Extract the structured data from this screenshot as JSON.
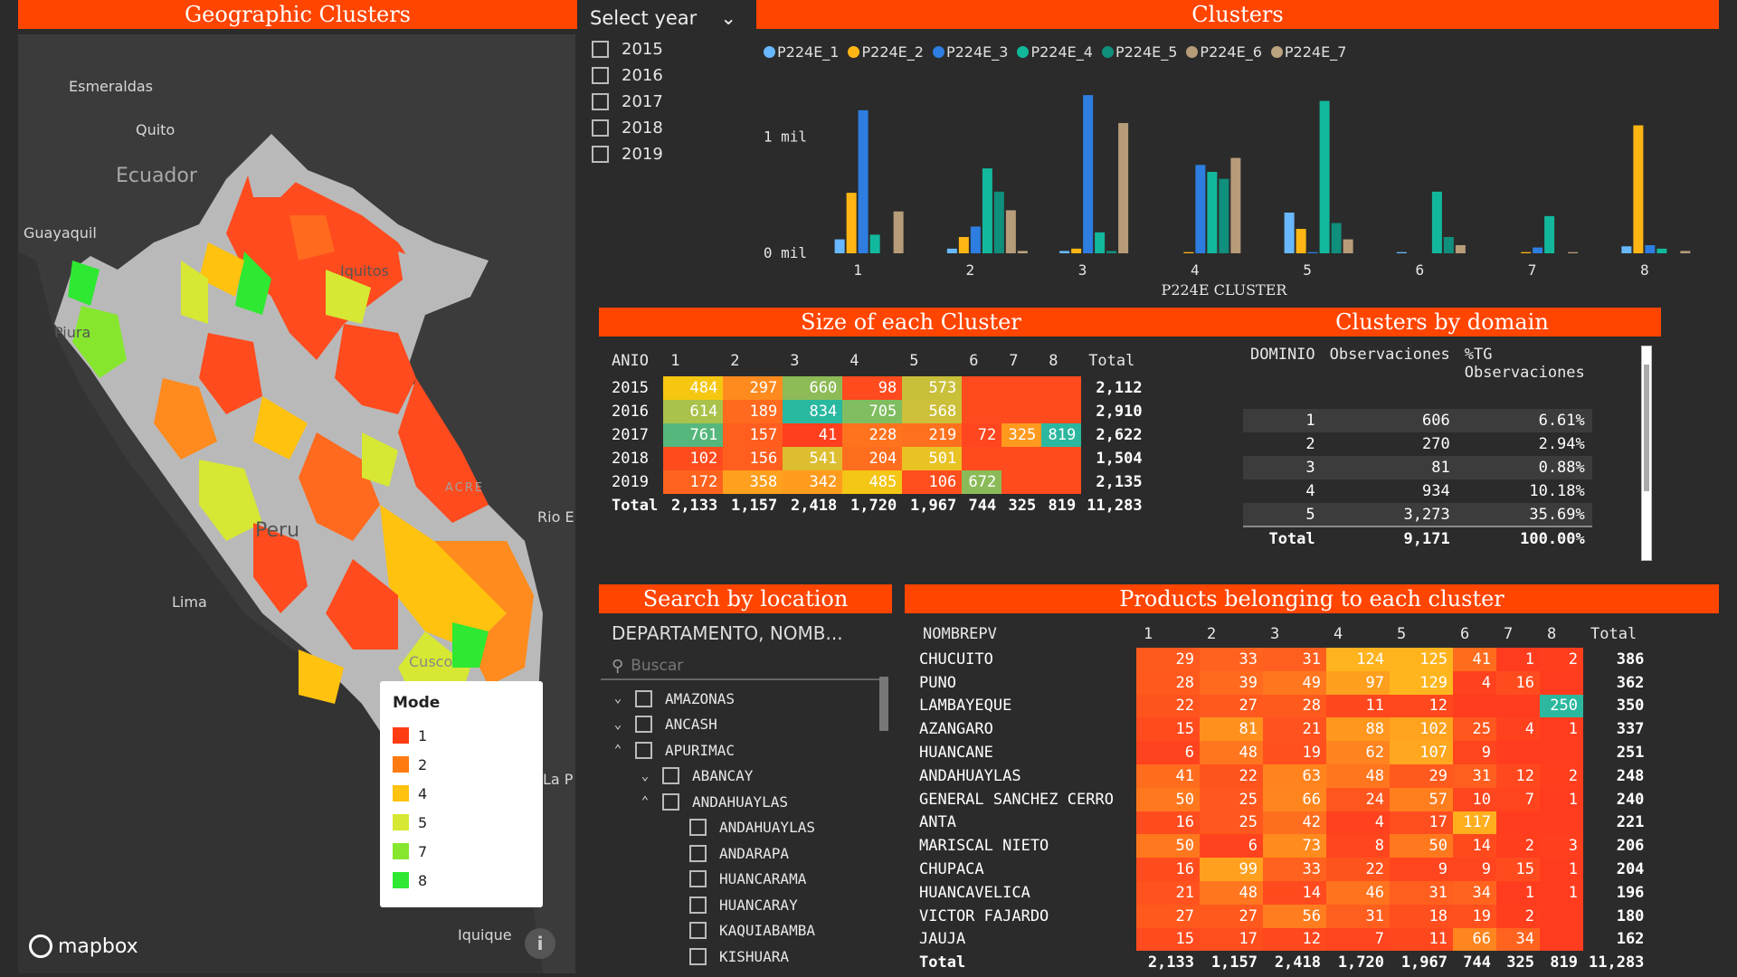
{
  "headers": {
    "geo": "Geographic Clusters",
    "clusters": "Clusters",
    "size": "Size of each Cluster",
    "domain": "Clusters by domain",
    "search": "Search by location",
    "products": "Products belonging to each cluster"
  },
  "map": {
    "labels": [
      "Esmeraldas",
      "Quito",
      "Ecuador",
      "Guayaquil",
      "Iquitos",
      "Piura",
      "ACRE",
      "Rio E",
      "Peru",
      "Lima",
      "Cusco",
      "La P",
      "Iquique"
    ],
    "legend_title": "Mode",
    "legend": [
      {
        "label": "1",
        "color": "#ff3d14"
      },
      {
        "label": "2",
        "color": "#ff7a10"
      },
      {
        "label": "4",
        "color": "#ffc20e"
      },
      {
        "label": "5",
        "color": "#d6e833"
      },
      {
        "label": "7",
        "color": "#86e62e"
      },
      {
        "label": "8",
        "color": "#2ee832"
      }
    ],
    "attribution": "mapbox",
    "info": "i"
  },
  "year_slicer": {
    "title": "Select year",
    "years": [
      "2015",
      "2016",
      "2017",
      "2018",
      "2019"
    ]
  },
  "chart_data": {
    "type": "bar",
    "categories": [
      "1",
      "2",
      "3",
      "4",
      "5",
      "6",
      "7",
      "8"
    ],
    "xlabel": "P224E CLUSTER",
    "ylabel": "",
    "yticks": [
      "0 mil",
      "1 mil"
    ],
    "ylim": [
      0,
      1400
    ],
    "series": [
      {
        "name": "P224E_1",
        "color": "#68b8ff",
        "values": [
          120,
          40,
          20,
          0,
          350,
          10,
          0,
          60
        ]
      },
      {
        "name": "P224E_2",
        "color": "#ffb615",
        "values": [
          520,
          140,
          40,
          10,
          210,
          0,
          10,
          1100
        ]
      },
      {
        "name": "P224E_3",
        "color": "#2d7ee0",
        "values": [
          1230,
          230,
          1360,
          760,
          10,
          0,
          50,
          70
        ]
      },
      {
        "name": "P224E_4",
        "color": "#12b89c",
        "values": [
          160,
          730,
          180,
          700,
          1310,
          530,
          320,
          40
        ]
      },
      {
        "name": "P224E_5",
        "color": "#0f8f7c",
        "values": [
          0,
          530,
          20,
          640,
          260,
          140,
          0,
          0
        ]
      },
      {
        "name": "P224E_6",
        "color": "#b79c7a",
        "values": [
          360,
          370,
          1120,
          820,
          120,
          70,
          10,
          20
        ]
      },
      {
        "name": "P224E_7",
        "color": "#bca37f",
        "values": [
          0,
          20,
          0,
          0,
          0,
          0,
          0,
          0
        ]
      }
    ]
  },
  "size_table": {
    "columns": [
      "ANIO",
      "1",
      "2",
      "3",
      "4",
      "5",
      "6",
      "7",
      "8",
      "Total"
    ],
    "rows": [
      {
        "year": "2015",
        "cells": [
          {
            "v": "484",
            "c": "#f5c710"
          },
          {
            "v": "297",
            "c": "#ff8a1e"
          },
          {
            "v": "660",
            "c": "#8dbb57"
          },
          {
            "v": "98",
            "c": "#ff4b1e"
          },
          {
            "v": "573",
            "c": "#c9c03a"
          },
          {
            "v": "",
            "c": "#ff4b1e"
          },
          {
            "v": "",
            "c": "#ff4b1e"
          },
          {
            "v": "",
            "c": "#ff4b1e"
          }
        ],
        "total": "2,112"
      },
      {
        "year": "2016",
        "cells": [
          {
            "v": "614",
            "c": "#a9c24b"
          },
          {
            "v": "189",
            "c": "#ff6a1e"
          },
          {
            "v": "834",
            "c": "#29b8a0"
          },
          {
            "v": "705",
            "c": "#7fbd60"
          },
          {
            "v": "568",
            "c": "#ccbf3a"
          },
          {
            "v": "",
            "c": "#ff4b1e"
          },
          {
            "v": "",
            "c": "#ff4b1e"
          },
          {
            "v": "",
            "c": "#ff4b1e"
          }
        ],
        "total": "2,910"
      },
      {
        "year": "2017",
        "cells": [
          {
            "v": "761",
            "c": "#55b77b"
          },
          {
            "v": "157",
            "c": "#ff5e1e"
          },
          {
            "v": "41",
            "c": "#ff3f1e"
          },
          {
            "v": "228",
            "c": "#ff721e"
          },
          {
            "v": "219",
            "c": "#ff701e"
          },
          {
            "v": "72",
            "c": "#ff461e"
          },
          {
            "v": "325",
            "c": "#ff9a1e"
          },
          {
            "v": "819",
            "c": "#2cb89e"
          }
        ],
        "total": "2,622"
      },
      {
        "year": "2018",
        "cells": [
          {
            "v": "102",
            "c": "#ff4c1e"
          },
          {
            "v": "156",
            "c": "#ff5e1e"
          },
          {
            "v": "541",
            "c": "#dcbe30"
          },
          {
            "v": "204",
            "c": "#ff6d1e"
          },
          {
            "v": "501",
            "c": "#e9c224"
          },
          {
            "v": "",
            "c": "#ff4b1e"
          },
          {
            "v": "",
            "c": "#ff4b1e"
          },
          {
            "v": "",
            "c": "#ff4b1e"
          }
        ],
        "total": "1,504"
      },
      {
        "year": "2019",
        "cells": [
          {
            "v": "172",
            "c": "#ff631e"
          },
          {
            "v": "358",
            "c": "#ffa01e"
          },
          {
            "v": "342",
            "c": "#ff9c1e"
          },
          {
            "v": "485",
            "c": "#f4c616"
          },
          {
            "v": "106",
            "c": "#ff4e1e"
          },
          {
            "v": "672",
            "c": "#8bbb58"
          },
          {
            "v": "",
            "c": "#ff4b1e"
          },
          {
            "v": "",
            "c": "#ff4b1e"
          }
        ],
        "total": "2,135"
      }
    ],
    "total_row": [
      "Total",
      "2,133",
      "1,157",
      "2,418",
      "1,720",
      "1,967",
      "744",
      "325",
      "819",
      "11,283"
    ]
  },
  "domain_table": {
    "columns": [
      "DOMINIO",
      "Observaciones",
      "%TG Observaciones"
    ],
    "rows": [
      [
        "1",
        "606",
        "6.61%"
      ],
      [
        "2",
        "270",
        "2.94%"
      ],
      [
        "3",
        "81",
        "0.88%"
      ],
      [
        "4",
        "934",
        "10.18%"
      ],
      [
        "5",
        "3,273",
        "35.69%"
      ]
    ],
    "total_row": [
      "Total",
      "9,171",
      "100.00%"
    ]
  },
  "location_slicer": {
    "field": "DEPARTAMENTO, NOMB...",
    "search_placeholder": "Buscar",
    "items": [
      {
        "label": "AMAZONAS",
        "level": 0,
        "chev": "⌄"
      },
      {
        "label": "ANCASH",
        "level": 0,
        "chev": "⌄"
      },
      {
        "label": "APURIMAC",
        "level": 0,
        "chev": "⌃"
      },
      {
        "label": "ABANCAY",
        "level": 1,
        "chev": "⌄"
      },
      {
        "label": "ANDAHUAYLAS",
        "level": 1,
        "chev": "⌃"
      },
      {
        "label": "ANDAHUAYLAS",
        "level": 2,
        "chev": ""
      },
      {
        "label": "ANDARAPA",
        "level": 2,
        "chev": ""
      },
      {
        "label": "HUANCARAMA",
        "level": 2,
        "chev": ""
      },
      {
        "label": "HUANCARAY",
        "level": 2,
        "chev": ""
      },
      {
        "label": "KAQUIABAMBA",
        "level": 2,
        "chev": ""
      },
      {
        "label": "KISHUARA",
        "level": 2,
        "chev": ""
      }
    ]
  },
  "product_table": {
    "columns": [
      "NOMBREPV",
      "1",
      "2",
      "3",
      "4",
      "5",
      "6",
      "7",
      "8",
      "Total"
    ],
    "rows": [
      {
        "name": "CHUCUITO",
        "cells": [
          {
            "v": "29",
            "c": "#ff5a1e"
          },
          {
            "v": "33",
            "c": "#ff621e"
          },
          {
            "v": "31",
            "c": "#ff5f1e"
          },
          {
            "v": "124",
            "c": "#ffb31e"
          },
          {
            "v": "125",
            "c": "#ffb41e"
          },
          {
            "v": "41",
            "c": "#ff6c1e"
          },
          {
            "v": "1",
            "c": "#ff3d1e"
          },
          {
            "v": "2",
            "c": "#ff3e1e"
          }
        ],
        "total": "386"
      },
      {
        "name": "PUNO",
        "cells": [
          {
            "v": "28",
            "c": "#ff591e"
          },
          {
            "v": "39",
            "c": "#ff6a1e"
          },
          {
            "v": "49",
            "c": "#ff761e"
          },
          {
            "v": "97",
            "c": "#ff9f1e"
          },
          {
            "v": "129",
            "c": "#ffb61e"
          },
          {
            "v": "4",
            "c": "#ff411e"
          },
          {
            "v": "16",
            "c": "#ff4c1e"
          },
          {
            "v": "",
            "c": "#ff3d1e"
          }
        ],
        "total": "362"
      },
      {
        "name": "LAMBAYEQUE",
        "cells": [
          {
            "v": "22",
            "c": "#ff531e"
          },
          {
            "v": "27",
            "c": "#ff591e"
          },
          {
            "v": "28",
            "c": "#ff5a1e"
          },
          {
            "v": "11",
            "c": "#ff471e"
          },
          {
            "v": "12",
            "c": "#ff481e"
          },
          {
            "v": "",
            "c": "#ff3d1e"
          },
          {
            "v": "",
            "c": "#ff3d1e"
          },
          {
            "v": "250",
            "c": "#2cb89e"
          }
        ],
        "total": "350"
      },
      {
        "name": "AZANGARO",
        "cells": [
          {
            "v": "15",
            "c": "#ff4b1e"
          },
          {
            "v": "81",
            "c": "#ff901e"
          },
          {
            "v": "21",
            "c": "#ff521e"
          },
          {
            "v": "88",
            "c": "#ff961e"
          },
          {
            "v": "102",
            "c": "#ffa31e"
          },
          {
            "v": "25",
            "c": "#ff571e"
          },
          {
            "v": "4",
            "c": "#ff411e"
          },
          {
            "v": "1",
            "c": "#ff3d1e"
          }
        ],
        "total": "337"
      },
      {
        "name": "HUANCANE",
        "cells": [
          {
            "v": "6",
            "c": "#ff431e"
          },
          {
            "v": "48",
            "c": "#ff761e"
          },
          {
            "v": "19",
            "c": "#ff501e"
          },
          {
            "v": "62",
            "c": "#ff831e"
          },
          {
            "v": "107",
            "c": "#ffa71e"
          },
          {
            "v": "9",
            "c": "#ff451e"
          },
          {
            "v": "",
            "c": "#ff3d1e"
          },
          {
            "v": "",
            "c": "#ff3d1e"
          }
        ],
        "total": "251"
      },
      {
        "name": "ANDAHUAYLAS",
        "cells": [
          {
            "v": "41",
            "c": "#ff6c1e"
          },
          {
            "v": "22",
            "c": "#ff531e"
          },
          {
            "v": "63",
            "c": "#ff841e"
          },
          {
            "v": "48",
            "c": "#ff761e"
          },
          {
            "v": "29",
            "c": "#ff5a1e"
          },
          {
            "v": "31",
            "c": "#ff5f1e"
          },
          {
            "v": "12",
            "c": "#ff481e"
          },
          {
            "v": "2",
            "c": "#ff3e1e"
          }
        ],
        "total": "248"
      },
      {
        "name": "GENERAL SANCHEZ CERRO",
        "cells": [
          {
            "v": "50",
            "c": "#ff781e"
          },
          {
            "v": "25",
            "c": "#ff571e"
          },
          {
            "v": "66",
            "c": "#ff861e"
          },
          {
            "v": "24",
            "c": "#ff561e"
          },
          {
            "v": "57",
            "c": "#ff7e1e"
          },
          {
            "v": "10",
            "c": "#ff461e"
          },
          {
            "v": "7",
            "c": "#ff441e"
          },
          {
            "v": "1",
            "c": "#ff3d1e"
          }
        ],
        "total": "240"
      },
      {
        "name": "ANTA",
        "cells": [
          {
            "v": "16",
            "c": "#ff4c1e"
          },
          {
            "v": "25",
            "c": "#ff571e"
          },
          {
            "v": "42",
            "c": "#ff6e1e"
          },
          {
            "v": "4",
            "c": "#ff411e"
          },
          {
            "v": "17",
            "c": "#ff4e1e"
          },
          {
            "v": "117",
            "c": "#ffae1e"
          },
          {
            "v": "",
            "c": "#ff3d1e"
          },
          {
            "v": "",
            "c": "#ff3d1e"
          }
        ],
        "total": "221"
      },
      {
        "name": "MARISCAL NIETO",
        "cells": [
          {
            "v": "50",
            "c": "#ff781e"
          },
          {
            "v": "6",
            "c": "#ff431e"
          },
          {
            "v": "73",
            "c": "#ff8b1e"
          },
          {
            "v": "8",
            "c": "#ff451e"
          },
          {
            "v": "50",
            "c": "#ff781e"
          },
          {
            "v": "14",
            "c": "#ff4a1e"
          },
          {
            "v": "2",
            "c": "#ff3e1e"
          },
          {
            "v": "3",
            "c": "#ff3f1e"
          }
        ],
        "total": "206"
      },
      {
        "name": "CHUPACA",
        "cells": [
          {
            "v": "16",
            "c": "#ff4c1e"
          },
          {
            "v": "99",
            "c": "#ffa11e"
          },
          {
            "v": "33",
            "c": "#ff621e"
          },
          {
            "v": "22",
            "c": "#ff531e"
          },
          {
            "v": "9",
            "c": "#ff451e"
          },
          {
            "v": "9",
            "c": "#ff451e"
          },
          {
            "v": "15",
            "c": "#ff4b1e"
          },
          {
            "v": "1",
            "c": "#ff3d1e"
          }
        ],
        "total": "204"
      },
      {
        "name": "HUANCAVELICA",
        "cells": [
          {
            "v": "21",
            "c": "#ff521e"
          },
          {
            "v": "48",
            "c": "#ff761e"
          },
          {
            "v": "14",
            "c": "#ff4a1e"
          },
          {
            "v": "46",
            "c": "#ff731e"
          },
          {
            "v": "31",
            "c": "#ff5f1e"
          },
          {
            "v": "34",
            "c": "#ff631e"
          },
          {
            "v": "1",
            "c": "#ff3d1e"
          },
          {
            "v": "1",
            "c": "#ff3d1e"
          }
        ],
        "total": "196"
      },
      {
        "name": "VICTOR FAJARDO",
        "cells": [
          {
            "v": "27",
            "c": "#ff591e"
          },
          {
            "v": "27",
            "c": "#ff591e"
          },
          {
            "v": "56",
            "c": "#ff7d1e"
          },
          {
            "v": "31",
            "c": "#ff5f1e"
          },
          {
            "v": "18",
            "c": "#ff4f1e"
          },
          {
            "v": "19",
            "c": "#ff501e"
          },
          {
            "v": "2",
            "c": "#ff3e1e"
          },
          {
            "v": "",
            "c": "#ff3d1e"
          }
        ],
        "total": "180"
      },
      {
        "name": "JAUJA",
        "cells": [
          {
            "v": "15",
            "c": "#ff4b1e"
          },
          {
            "v": "17",
            "c": "#ff4e1e"
          },
          {
            "v": "12",
            "c": "#ff481e"
          },
          {
            "v": "7",
            "c": "#ff441e"
          },
          {
            "v": "11",
            "c": "#ff471e"
          },
          {
            "v": "66",
            "c": "#ff861e"
          },
          {
            "v": "34",
            "c": "#ff631e"
          },
          {
            "v": "",
            "c": "#ff3d1e"
          }
        ],
        "total": "162"
      }
    ],
    "total_row": [
      "Total",
      "2,133",
      "1,157",
      "2,418",
      "1,720",
      "1,967",
      "744",
      "325",
      "819",
      "11,283"
    ]
  }
}
